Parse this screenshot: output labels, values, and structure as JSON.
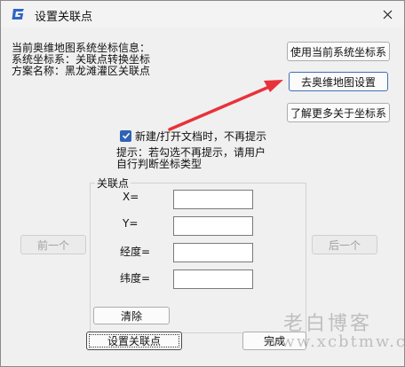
{
  "window": {
    "title": "设置关联点",
    "app_icon": "G-logo-icon",
    "close_icon": "close-icon"
  },
  "info": {
    "line1": "当前奥维地图系统坐标信息：",
    "line2": "系统坐标系：关联点转换坐标",
    "line3": "方案名称：黑龙滩灌区关联点"
  },
  "buttons": {
    "use_system": "使用当前系统坐标系",
    "goto_ovi": "去奥维地图设置",
    "learn_more": "了解更多关于坐标系",
    "prev": "前一个",
    "next": "后一个",
    "clear": "清除",
    "set_point": "设置关联点",
    "done": "完成"
  },
  "checkbox": {
    "label": "新建/打开文档时，不再提示",
    "checked": true
  },
  "hint": {
    "line1": "提示：若勾选不再提示，请用户",
    "line2": "自行判断坐标类型"
  },
  "group": {
    "label": "关联点",
    "fields": [
      {
        "label": "X=",
        "value": ""
      },
      {
        "label": "Y=",
        "value": ""
      },
      {
        "label": "经度=",
        "value": ""
      },
      {
        "label": "纬度=",
        "value": ""
      }
    ]
  },
  "watermark": {
    "line1": "老白博客",
    "line2": "www.xcbtmw.com"
  },
  "colors": {
    "arrow": "#e8323a",
    "checkbox": "#2e63b6",
    "primary_border": "#3f6fb5"
  }
}
